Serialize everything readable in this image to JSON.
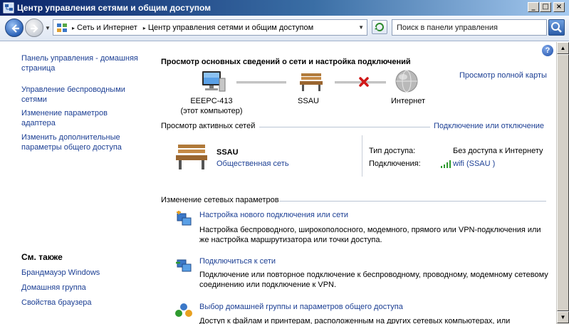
{
  "window": {
    "title": "Центр управления сетями и общим доступом",
    "buttons": {
      "minimize": "_",
      "maximize": "□",
      "close": "×"
    }
  },
  "addressbar": {
    "breadcrumbs": [
      "Сеть и Интернет",
      "Центр управления сетями и общим доступом"
    ],
    "search_placeholder": "Поиск в панели управления"
  },
  "sidebar": {
    "links": [
      "Панель управления - домашняя страница",
      "Управление беспроводными сетями",
      "Изменение параметров адаптера",
      "Изменить дополнительные параметры общего доступа"
    ],
    "see_also_title": "См. также",
    "see_also": [
      "Брандмауэр Windows",
      "Домашняя группа",
      "Свойства браузера"
    ]
  },
  "main": {
    "help_label": "?",
    "heading": "Просмотр основных сведений о сети и настройка подключений",
    "full_map_link": "Просмотр полной карты",
    "map": {
      "computer_name": "EEEPC-413",
      "computer_sub": "(этот компьютер)",
      "network_name": "SSAU",
      "internet_label": "Интернет"
    },
    "active_networks_title": "Просмотр активных сетей",
    "connect_disconnect_link": "Подключение или отключение",
    "active_network": {
      "name": "SSAU",
      "type": "Общественная сеть",
      "access_type_label": "Тип доступа:",
      "access_type_value": "Без доступа к Интернету",
      "connections_label": "Подключения:",
      "connections_value": "wifi (SSAU )"
    },
    "change_settings_title": "Изменение сетевых параметров",
    "tasks": [
      {
        "link": "Настройка нового подключения или сети",
        "desc": "Настройка беспроводного, широкополосного, модемного, прямого или VPN-подключения или же настройка маршрутизатора или точки доступа."
      },
      {
        "link": "Подключиться к сети",
        "desc": "Подключение или повторное подключение к беспроводному, проводному, модемному сетевому соединению или подключение к VPN."
      },
      {
        "link": "Выбор домашней группы и параметров общего доступа",
        "desc": "Доступ к файлам и принтерам, расположенным на других сетевых компьютерах, или"
      }
    ]
  },
  "colors": {
    "link": "#1c3f94",
    "title_start": "#0a246a",
    "title_end": "#a6caf0"
  }
}
